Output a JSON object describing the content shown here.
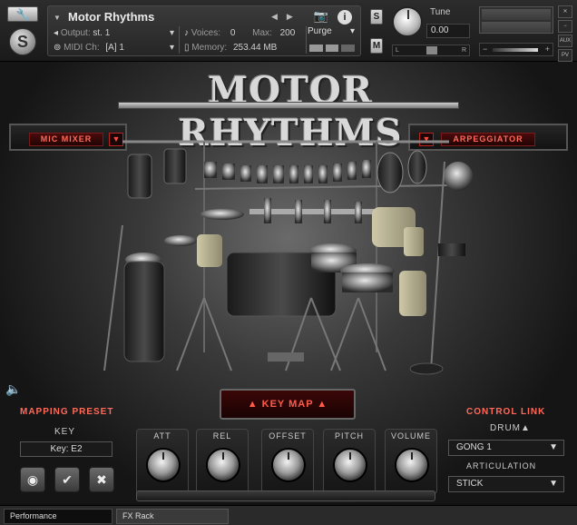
{
  "header": {
    "instrument_name": "Motor Rhythms",
    "output_label": "Output:",
    "output_value": "st. 1",
    "voices_label": "Voices:",
    "voices_value": "0",
    "max_label": "Max:",
    "max_value": "200",
    "midi_label": "MIDI Ch:",
    "midi_value": "[A]  1",
    "memory_label": "Memory:",
    "memory_value": "253.44 MB",
    "purge_label": "Purge",
    "solo_label": "S",
    "mute_label": "M",
    "tune_label": "Tune",
    "tune_value": "0.00",
    "pan_left": "L",
    "pan_right": "R",
    "aux_label": "AUX",
    "pv_label": "PV"
  },
  "main": {
    "title": "MOTOR RHYTHMS",
    "mic_mixer_label": "MIC MIXER",
    "arpeggiator_label": "ARPEGGIATOR",
    "mapping_preset_label": "MAPPING PRESET",
    "key_map_label": "▲ KEY MAP ▲",
    "control_link_label": "CONTROL LINK"
  },
  "controls": {
    "key_section_label": "KEY",
    "key_field": "Key:    E2",
    "knobs": [
      {
        "label": "ATT"
      },
      {
        "label": "REL"
      },
      {
        "label": "OFFSET"
      },
      {
        "label": "PITCH"
      },
      {
        "label": "VOLUME"
      }
    ],
    "drum_label": "DRUM▲",
    "drum_value": "GONG 1",
    "articulation_label": "ARTICULATION",
    "articulation_value": "STICK"
  },
  "tabs": [
    {
      "label": "Performance"
    },
    {
      "label": "FX Rack"
    }
  ]
}
